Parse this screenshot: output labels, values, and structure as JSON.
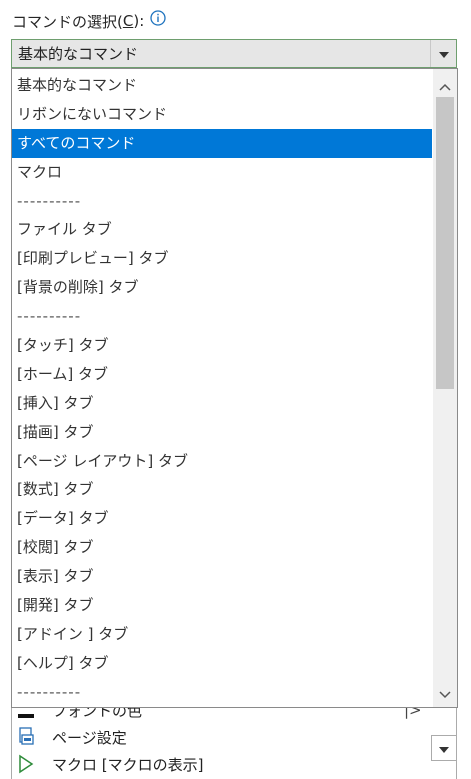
{
  "label": {
    "prefix": "コマンドの選択(",
    "accesskey": "C",
    "suffix": "):"
  },
  "combo": {
    "selected_value": "基本的なコマンド"
  },
  "dropdown": {
    "items": [
      {
        "label": "基本的なコマンド",
        "selected": false
      },
      {
        "label": "リボンにないコマンド",
        "selected": false
      },
      {
        "label": "すべてのコマンド",
        "selected": true
      },
      {
        "label": "マクロ",
        "selected": false
      },
      {
        "label": "----------",
        "selected": false
      },
      {
        "label": "ファイル タブ",
        "selected": false
      },
      {
        "label": "[印刷プレビュー] タブ",
        "selected": false
      },
      {
        "label": "[背景の削除] タブ",
        "selected": false
      },
      {
        "label": "----------",
        "selected": false
      },
      {
        "label": "[タッチ] タブ",
        "selected": false
      },
      {
        "label": "[ホーム] タブ",
        "selected": false
      },
      {
        "label": "[挿入] タブ",
        "selected": false
      },
      {
        "label": "[描画] タブ",
        "selected": false
      },
      {
        "label": "[ページ レイアウト] タブ",
        "selected": false
      },
      {
        "label": "[数式] タブ",
        "selected": false
      },
      {
        "label": "[データ] タブ",
        "selected": false
      },
      {
        "label": "[校閲] タブ",
        "selected": false
      },
      {
        "label": "[表示] タブ",
        "selected": false
      },
      {
        "label": "[開発] タブ",
        "selected": false
      },
      {
        "label": "[アドイン ] タブ",
        "selected": false
      },
      {
        "label": "[ヘルプ] タブ",
        "selected": false
      },
      {
        "label": "----------",
        "selected": false
      }
    ]
  },
  "background_list": {
    "rows": [
      {
        "label": "フォントの色",
        "icon": "font-color-icon"
      },
      {
        "label": "ページ設定",
        "icon": "page-setup-icon"
      },
      {
        "label": "マクロ [マクロの表示]",
        "icon": "macro-play-icon"
      }
    ]
  },
  "colors": {
    "selection": "#0078d7",
    "combo_border": "#6e9e6e",
    "info_icon": "#1e73be"
  }
}
